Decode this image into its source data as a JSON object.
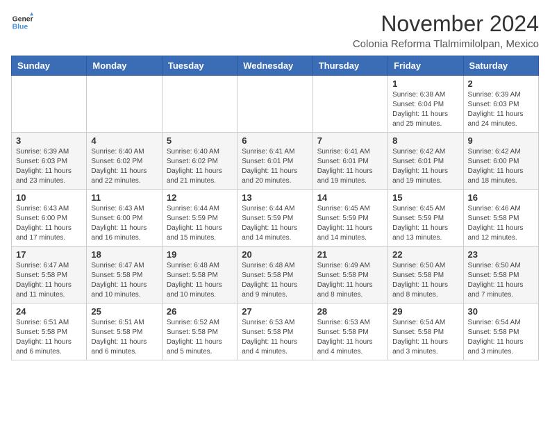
{
  "logo": {
    "line1": "General",
    "line2": "Blue"
  },
  "title": "November 2024",
  "subtitle": "Colonia Reforma Tlalmimilolpan, Mexico",
  "days_of_week": [
    "Sunday",
    "Monday",
    "Tuesday",
    "Wednesday",
    "Thursday",
    "Friday",
    "Saturday"
  ],
  "weeks": [
    [
      {
        "day": "",
        "info": ""
      },
      {
        "day": "",
        "info": ""
      },
      {
        "day": "",
        "info": ""
      },
      {
        "day": "",
        "info": ""
      },
      {
        "day": "",
        "info": ""
      },
      {
        "day": "1",
        "info": "Sunrise: 6:38 AM\nSunset: 6:04 PM\nDaylight: 11 hours and 25 minutes."
      },
      {
        "day": "2",
        "info": "Sunrise: 6:39 AM\nSunset: 6:03 PM\nDaylight: 11 hours and 24 minutes."
      }
    ],
    [
      {
        "day": "3",
        "info": "Sunrise: 6:39 AM\nSunset: 6:03 PM\nDaylight: 11 hours and 23 minutes."
      },
      {
        "day": "4",
        "info": "Sunrise: 6:40 AM\nSunset: 6:02 PM\nDaylight: 11 hours and 22 minutes."
      },
      {
        "day": "5",
        "info": "Sunrise: 6:40 AM\nSunset: 6:02 PM\nDaylight: 11 hours and 21 minutes."
      },
      {
        "day": "6",
        "info": "Sunrise: 6:41 AM\nSunset: 6:01 PM\nDaylight: 11 hours and 20 minutes."
      },
      {
        "day": "7",
        "info": "Sunrise: 6:41 AM\nSunset: 6:01 PM\nDaylight: 11 hours and 19 minutes."
      },
      {
        "day": "8",
        "info": "Sunrise: 6:42 AM\nSunset: 6:01 PM\nDaylight: 11 hours and 19 minutes."
      },
      {
        "day": "9",
        "info": "Sunrise: 6:42 AM\nSunset: 6:00 PM\nDaylight: 11 hours and 18 minutes."
      }
    ],
    [
      {
        "day": "10",
        "info": "Sunrise: 6:43 AM\nSunset: 6:00 PM\nDaylight: 11 hours and 17 minutes."
      },
      {
        "day": "11",
        "info": "Sunrise: 6:43 AM\nSunset: 6:00 PM\nDaylight: 11 hours and 16 minutes."
      },
      {
        "day": "12",
        "info": "Sunrise: 6:44 AM\nSunset: 5:59 PM\nDaylight: 11 hours and 15 minutes."
      },
      {
        "day": "13",
        "info": "Sunrise: 6:44 AM\nSunset: 5:59 PM\nDaylight: 11 hours and 14 minutes."
      },
      {
        "day": "14",
        "info": "Sunrise: 6:45 AM\nSunset: 5:59 PM\nDaylight: 11 hours and 14 minutes."
      },
      {
        "day": "15",
        "info": "Sunrise: 6:45 AM\nSunset: 5:59 PM\nDaylight: 11 hours and 13 minutes."
      },
      {
        "day": "16",
        "info": "Sunrise: 6:46 AM\nSunset: 5:58 PM\nDaylight: 11 hours and 12 minutes."
      }
    ],
    [
      {
        "day": "17",
        "info": "Sunrise: 6:47 AM\nSunset: 5:58 PM\nDaylight: 11 hours and 11 minutes."
      },
      {
        "day": "18",
        "info": "Sunrise: 6:47 AM\nSunset: 5:58 PM\nDaylight: 11 hours and 10 minutes."
      },
      {
        "day": "19",
        "info": "Sunrise: 6:48 AM\nSunset: 5:58 PM\nDaylight: 11 hours and 10 minutes."
      },
      {
        "day": "20",
        "info": "Sunrise: 6:48 AM\nSunset: 5:58 PM\nDaylight: 11 hours and 9 minutes."
      },
      {
        "day": "21",
        "info": "Sunrise: 6:49 AM\nSunset: 5:58 PM\nDaylight: 11 hours and 8 minutes."
      },
      {
        "day": "22",
        "info": "Sunrise: 6:50 AM\nSunset: 5:58 PM\nDaylight: 11 hours and 8 minutes."
      },
      {
        "day": "23",
        "info": "Sunrise: 6:50 AM\nSunset: 5:58 PM\nDaylight: 11 hours and 7 minutes."
      }
    ],
    [
      {
        "day": "24",
        "info": "Sunrise: 6:51 AM\nSunset: 5:58 PM\nDaylight: 11 hours and 6 minutes."
      },
      {
        "day": "25",
        "info": "Sunrise: 6:51 AM\nSunset: 5:58 PM\nDaylight: 11 hours and 6 minutes."
      },
      {
        "day": "26",
        "info": "Sunrise: 6:52 AM\nSunset: 5:58 PM\nDaylight: 11 hours and 5 minutes."
      },
      {
        "day": "27",
        "info": "Sunrise: 6:53 AM\nSunset: 5:58 PM\nDaylight: 11 hours and 4 minutes."
      },
      {
        "day": "28",
        "info": "Sunrise: 6:53 AM\nSunset: 5:58 PM\nDaylight: 11 hours and 4 minutes."
      },
      {
        "day": "29",
        "info": "Sunrise: 6:54 AM\nSunset: 5:58 PM\nDaylight: 11 hours and 3 minutes."
      },
      {
        "day": "30",
        "info": "Sunrise: 6:54 AM\nSunset: 5:58 PM\nDaylight: 11 hours and 3 minutes."
      }
    ]
  ]
}
